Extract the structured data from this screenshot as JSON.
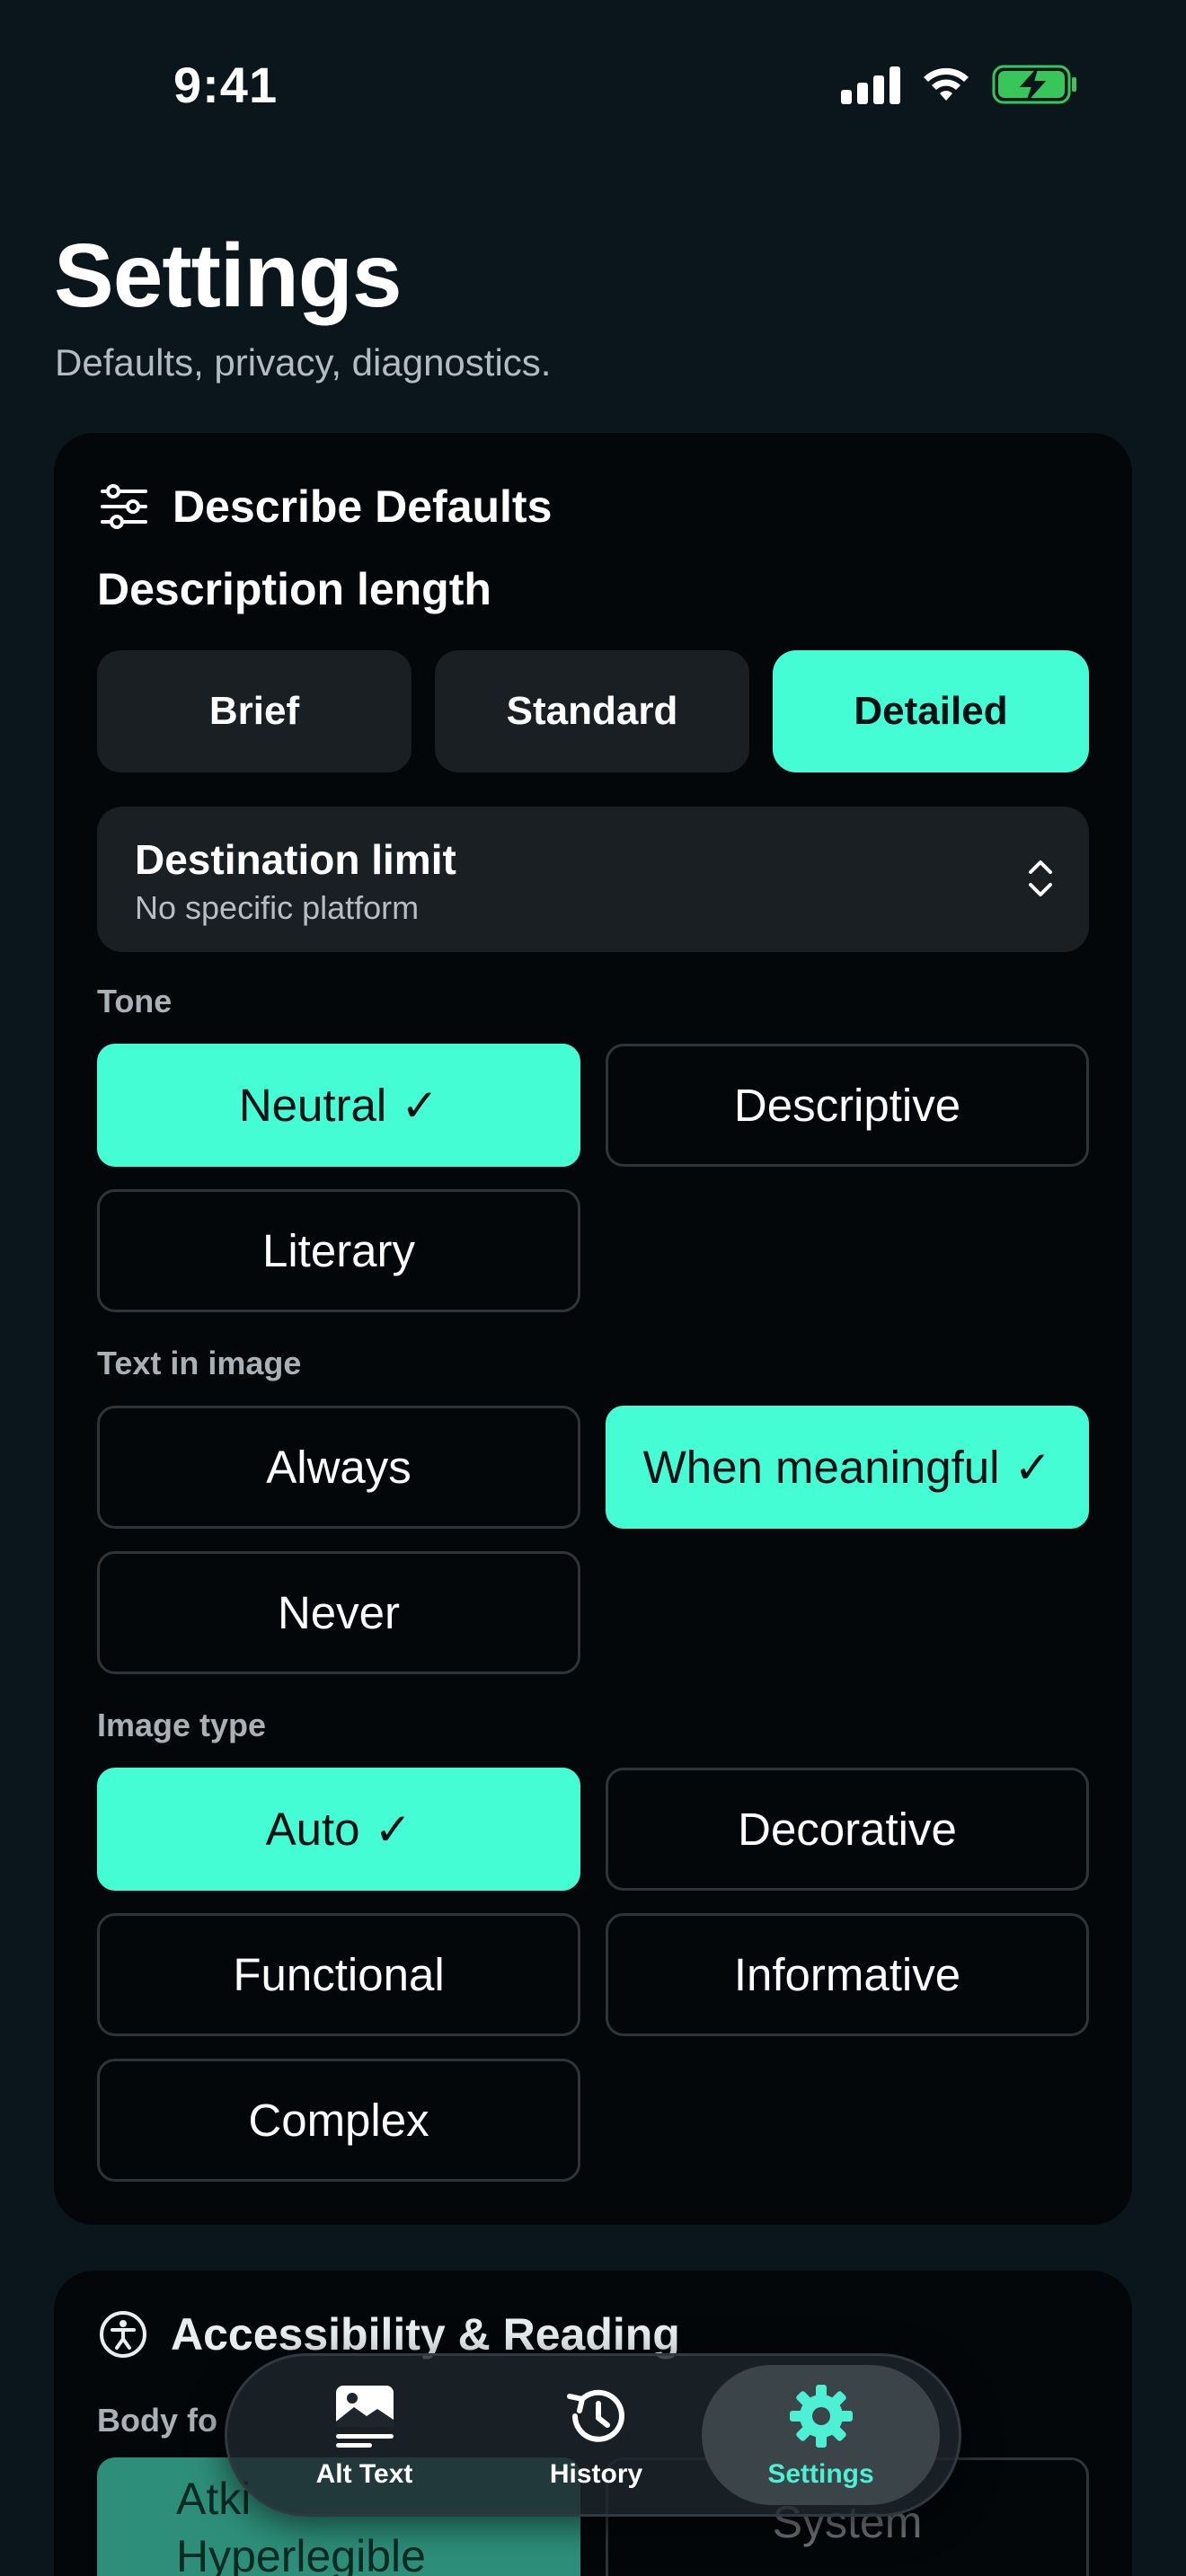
{
  "status_bar": {
    "time": "9:41"
  },
  "header": {
    "title": "Settings",
    "subtitle": "Defaults, privacy, diagnostics."
  },
  "defaults_card": {
    "title": "Describe Defaults",
    "length_title": "Description length",
    "length_options": [
      "Brief",
      "Standard",
      "Detailed"
    ],
    "length_selected": "Detailed",
    "destination": {
      "title": "Destination limit",
      "value": "No specific platform"
    },
    "tone": {
      "label": "Tone",
      "options": [
        "Neutral",
        "Descriptive",
        "Literary"
      ],
      "selected": "Neutral"
    },
    "text_in_image": {
      "label": "Text in image",
      "options": [
        "Always",
        "When meaningful",
        "Never"
      ],
      "selected": "When meaningful"
    },
    "image_type": {
      "label": "Image type",
      "options": [
        "Auto",
        "Decorative",
        "Functional",
        "Informative",
        "Complex"
      ],
      "selected": "Auto"
    },
    "check_mark": "✓"
  },
  "accessibility_card": {
    "title": "Accessibility & Reading",
    "body_font_label": "Body fo",
    "font_left_line1": "Atki",
    "font_left_line2": "Hyperlegible",
    "font_right": "System"
  },
  "tab_bar": {
    "tabs": [
      {
        "label": "Alt Text",
        "icon": "image-icon"
      },
      {
        "label": "History",
        "icon": "history-icon"
      },
      {
        "label": "Settings",
        "icon": "gear-icon"
      }
    ],
    "active": "Settings"
  },
  "colors": {
    "background": "#0b161c",
    "card": "#03070a",
    "accent": "#44fdd4",
    "segment": "#1a1f24"
  }
}
